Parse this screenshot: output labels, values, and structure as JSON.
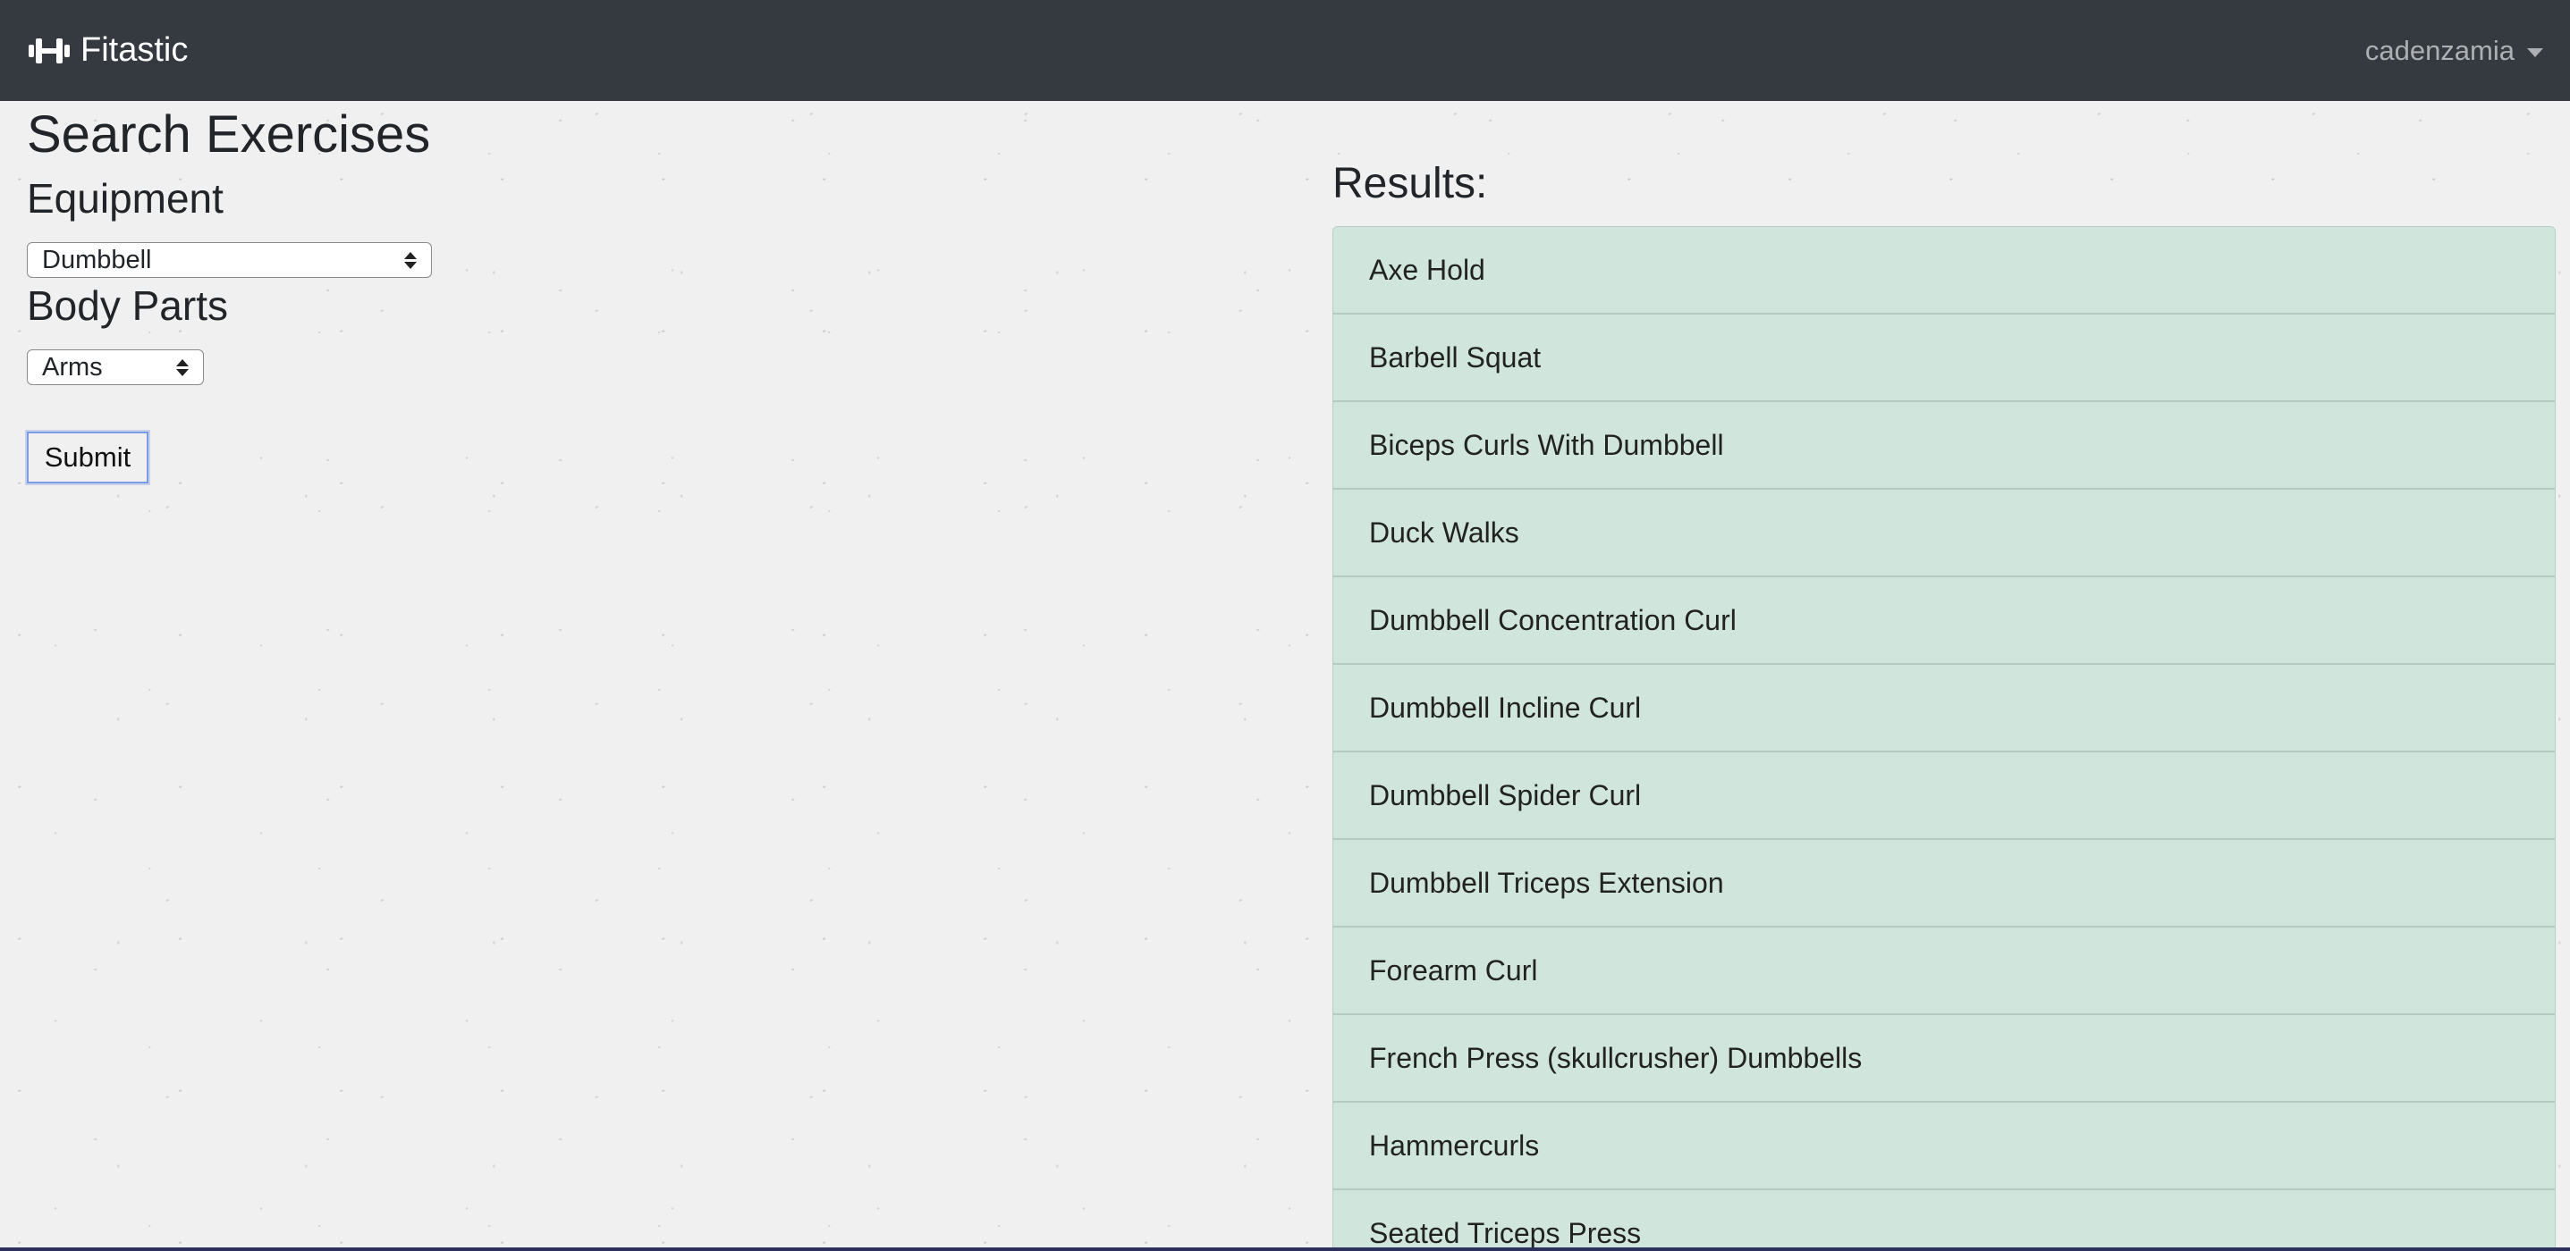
{
  "navbar": {
    "brand": "Fitastic",
    "brand_icon": "dumbbell-icon",
    "user": "cadenzamia"
  },
  "search": {
    "title": "Search Exercises",
    "equipment_label": "Equipment",
    "equipment_value": "Dumbbell",
    "body_parts_label": "Body Parts",
    "body_parts_value": "Arms",
    "submit_label": "Submit"
  },
  "results": {
    "title": "Results:",
    "items": [
      "Axe Hold",
      "Barbell Squat",
      "Biceps Curls With Dumbbell",
      "Duck Walks",
      "Dumbbell Concentration Curl",
      "Dumbbell Incline Curl",
      "Dumbbell Spider Curl",
      "Dumbbell Triceps Extension",
      "Forearm Curl",
      "French Press (skullcrusher) Dumbbells",
      "Hammercurls",
      "Seated Triceps Press"
    ]
  },
  "colors": {
    "navbar_bg": "#343a40",
    "result_bg": "#d0e5dc",
    "page_bg": "#f0f0f0"
  }
}
